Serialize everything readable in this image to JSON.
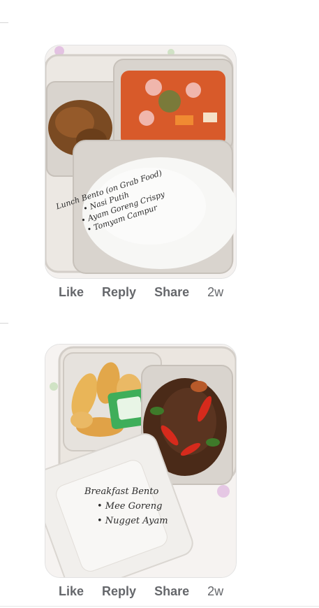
{
  "posts": [
    {
      "caption": {
        "title": "Lunch Bento (on Grab Food)",
        "items": [
          "• Nasi Putih",
          "• Ayam Goreng Crispy",
          "• Tomyam Campur"
        ]
      },
      "actions": {
        "like": "Like",
        "reply": "Reply",
        "share": "Share",
        "time": "2w"
      }
    },
    {
      "caption": {
        "title": "Breakfast Bento",
        "items": [
          "• Mee Goreng",
          "• Nugget Ayam"
        ]
      },
      "actions": {
        "like": "Like",
        "reply": "Reply",
        "share": "Share",
        "time": "2w"
      }
    }
  ],
  "colors": {
    "action_text": "#65676b",
    "tablecloth": "#f4f1ef",
    "container": "#e8e4df",
    "rice": "#f7f7f5",
    "tomyam": "#d85a2a",
    "fried_chicken": "#7a4a22",
    "noodles": "#4a2a18",
    "nugget": "#e9b558",
    "chili": "#d62a1c",
    "sauce_pack": "#3fae5a"
  }
}
